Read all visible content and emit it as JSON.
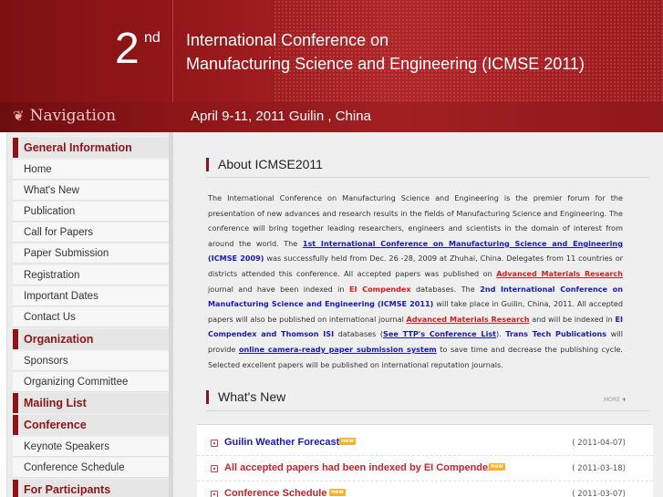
{
  "header": {
    "ordinal_number": "2",
    "ordinal_suffix": "nd",
    "title_line1": "International Conference on",
    "title_line2": "Manufacturing Science and Engineering  (ICMSE 2011)",
    "nav_heading": "Navigation",
    "date_location": "April 9-11, 2011 Guilin , China"
  },
  "sidebar": {
    "sections": [
      {
        "label": "General Information",
        "items": [
          "Home",
          "What's New",
          "Publication",
          "Call for Papers",
          "Paper Submission",
          "Registration",
          "Important Dates",
          "Contact Us"
        ]
      },
      {
        "label": "Organization",
        "items": [
          "Sponsors",
          "Organizing Committee"
        ]
      },
      {
        "label": "Mailing List",
        "items": []
      },
      {
        "label": "Conference",
        "items": [
          "Keynote Speakers",
          "Conference Schedule"
        ]
      },
      {
        "label": "For Participants",
        "items": []
      }
    ]
  },
  "about": {
    "title": "About  ICMSE2011",
    "p1": "The International Conference on Manufacturing Science and Engineering is the premier forum for the presentation of new advances and research results in the fields of Manufacturing Science and Engineering. The conference will bring together leading researchers, engineers and scientists in the domain of interest from around the world. The ",
    "link1": "1st International Conference on Manufacturing Science and Engineering",
    "p2": " (ICMSE 2009)",
    "p3": " was successfully held from Dec. 26 -28, 2009 at Zhuhai, China. Delegates from 11 countries or districts attended this conference. All accepted papers was published on ",
    "link2": "Advanced Materials Research",
    "p4": " journal and have been indexed in ",
    "red1": "EI Compendex",
    "p5": " databases. The ",
    "blue1": "2nd International Conference on Manufacturing Science and Engineering (ICMSE 2011)",
    "p6": " will take place in Guilin, China, 2011. All accepted papers will also be published on international journal ",
    "link3": "Advanced Materials Research",
    "p7": " and will be indexed in ",
    "red2": "EI Compendex and Thomson ISI",
    "p8": " databases (",
    "link4": "See TTP's Conference List",
    "p9": "). ",
    "blue2": "Trans Tech Publications",
    "p10": " will provide ",
    "link5": "online camera-ready paper submission system",
    "p11": " to save time and decrease the publishing cycle. Selected excellent papers will be published on international reputation journals."
  },
  "whats_new": {
    "title": "What's  New",
    "more_label": "MORE",
    "more_plus": "+",
    "badge": "new",
    "items": [
      {
        "title": "Guilin Weather Forecast",
        "color": "#1a1ab8",
        "date": "( 2011-04-07)"
      },
      {
        "title": "All accepted papers had been indexed by EI Compendex.",
        "color": "#c1272d",
        "date": "( 2011-03-18)"
      },
      {
        "title": "Conference Schedule",
        "color": "#c1272d",
        "date": "( 2011-03-07)"
      }
    ]
  },
  "colors": {
    "brand_red": "#8b1518",
    "link_blue": "#1a1ab8",
    "accent_red": "#d61f1f",
    "badge_orange": "#ffae2b"
  }
}
